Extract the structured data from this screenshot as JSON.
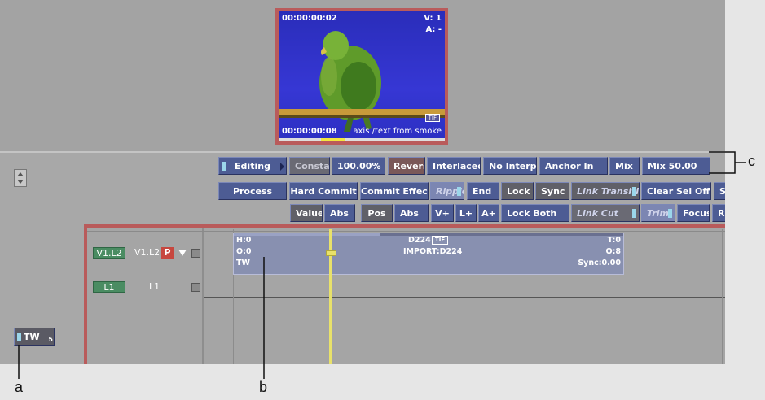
{
  "viewer": {
    "timecode_top": "00:00:00:02",
    "track_video": "V: 1",
    "track_audio": "A: -",
    "timecode_bottom": "00:00:00:08",
    "clip_name": "axis /text from smoke",
    "format_badge": "TIF"
  },
  "toolbar": {
    "row1": {
      "editing": "Editing",
      "constant": "Constant",
      "speed": "100.00%",
      "reverse": "Reverse",
      "interlaced": "Interlaced",
      "no_interp": "No Interp",
      "anchor_in": "Anchor In",
      "mix": "Mix",
      "mix_value": "Mix 50.00"
    },
    "row2": {
      "process": "Process",
      "hard_commit": "Hard Commit",
      "commit_effect": "Commit Effect",
      "ripple": "Ripple",
      "end": "End",
      "lock": "Lock",
      "sync": "Sync",
      "link_transition": "Link Transition",
      "clear_sel_offset": "Clear Sel Offset",
      "cut_s": "S"
    },
    "row3": {
      "value": "Value",
      "abs1": "Abs",
      "pos": "Pos",
      "abs2": "Abs",
      "v_plus": "V+",
      "l_plus": "L+",
      "a_plus": "A+",
      "lock_both": "Lock Both",
      "link_cut": "Link Cut",
      "trim": "Trim",
      "focus": "Focus",
      "cut_re": "Re"
    }
  },
  "tracks": [
    {
      "patch": "V1.L2",
      "name": "V1.L2",
      "badge": "P"
    },
    {
      "patch": "L1",
      "name": "L1"
    }
  ],
  "segment": {
    "h": "H:0",
    "o": "O:0",
    "tw": "TW",
    "name": "D224",
    "badge": "TIF",
    "source": "IMPORT:D224",
    "t": "T:0",
    "count": "O:8",
    "sync": "Sync:0.00"
  },
  "tw_button": {
    "label": "TW",
    "suffix": "5"
  },
  "callouts": {
    "a": "a",
    "b": "b",
    "c": "c"
  }
}
